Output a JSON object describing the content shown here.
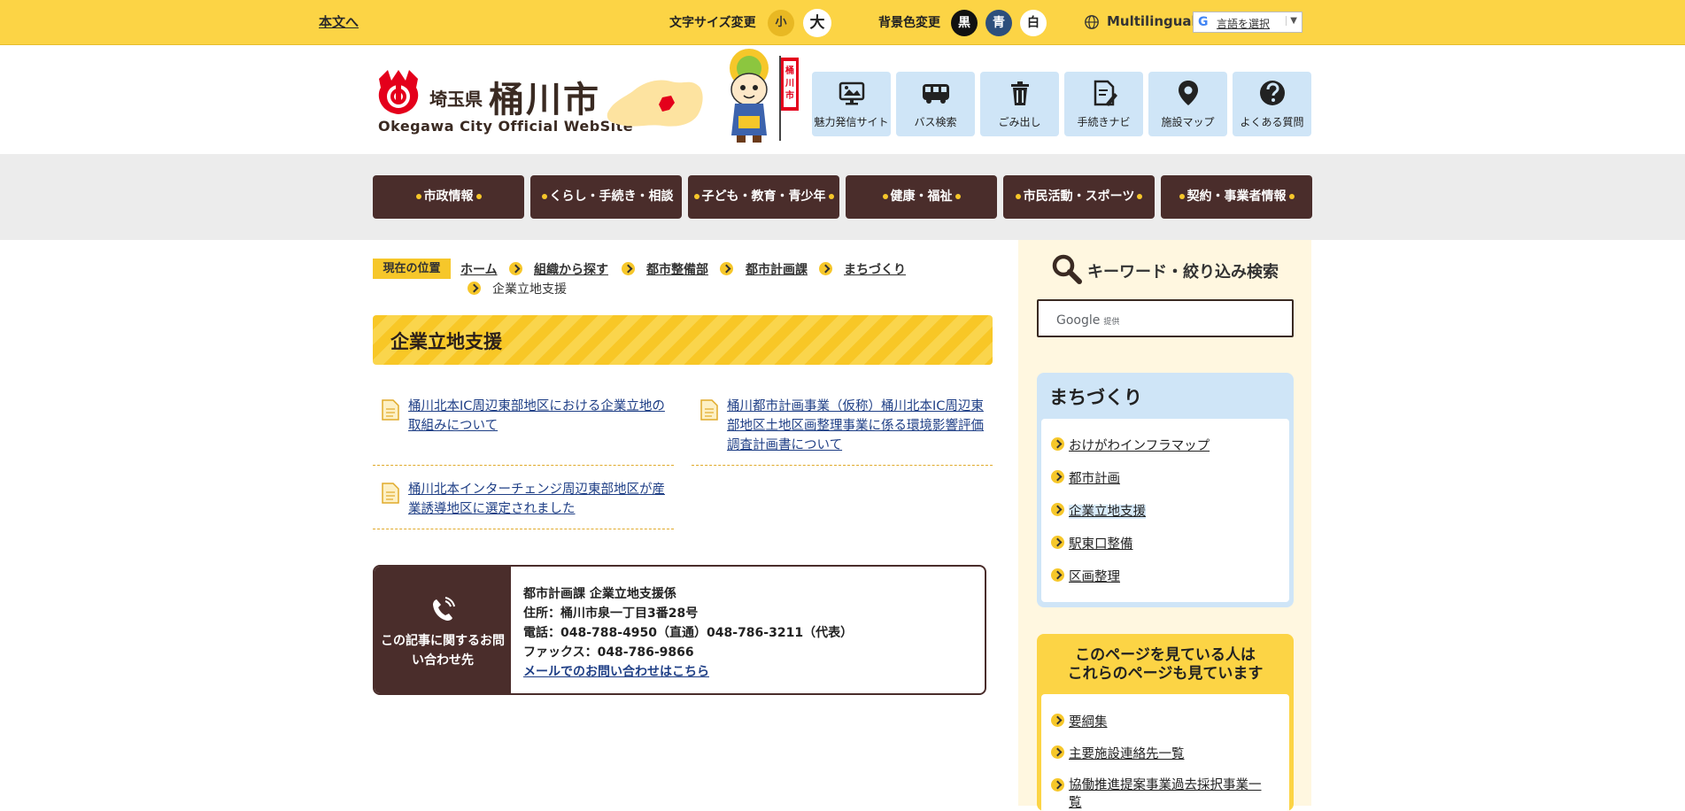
{
  "topbar": {
    "skip_link": "本文へ",
    "font_size_label": "文字サイズ変更",
    "font_small": "小",
    "font_large": "大",
    "bg_color_label": "背景色変更",
    "bg_black": "黒",
    "bg_blue": "青",
    "bg_white": "白",
    "multilingual": "Multilingual",
    "language_select": "言語を選択",
    "language_g": "G"
  },
  "header": {
    "logo_pref": "埼玉県",
    "logo_city": "桶川市",
    "logo_en": "Okegawa City Official WebSite",
    "mascot_flag": "桶川市"
  },
  "quick_nav": [
    {
      "label": "魅力発信サイト",
      "icon": "monitor-icon"
    },
    {
      "label": "バス検索",
      "icon": "bus-icon"
    },
    {
      "label": "ごみ出し",
      "icon": "trash-icon"
    },
    {
      "label": "手続きナビ",
      "icon": "document-pen-icon"
    },
    {
      "label": "施設マップ",
      "icon": "map-pin-icon"
    },
    {
      "label": "よくある質問",
      "icon": "question-icon"
    }
  ],
  "global_nav": [
    {
      "label": "市政情報"
    },
    {
      "label": "くらし・手続き・相談"
    },
    {
      "label": "子ども・教育・青少年"
    },
    {
      "label": "健康・福祉"
    },
    {
      "label": "市民活動・スポーツ"
    },
    {
      "label": "契約・事業者情報"
    }
  ],
  "breadcrumb": {
    "label": "現在の位置",
    "items": [
      "ホーム",
      "組織から探す",
      "都市整備部",
      "都市計画課",
      "まちづくり"
    ],
    "current": "企業立地支援"
  },
  "page": {
    "title": "企業立地支援"
  },
  "documents": [
    {
      "title": "桶川北本IC周辺東部地区における企業立地の取組みについて"
    },
    {
      "title": "桶川都市計画事業（仮称）桶川北本IC周辺東部地区土地区画整理事業に係る環境影響評価調査計画書について"
    },
    {
      "title": "桶川北本インターチェンジ周辺東部地区が産業誘導地区に選定されました"
    }
  ],
  "contact": {
    "label": "この記事に関するお問い合わせ先",
    "dept": "都市計画課 企業立地支援係",
    "address": "住所：桶川市泉一丁目3番28号",
    "phone": "電話：048-788-4950（直通）048-786-3211（代表）",
    "fax": "ファックス：048-786-9866",
    "mail_link": "メールでのお問い合わせはこちら"
  },
  "search": {
    "title": "キーワード・絞り込み検索",
    "google_label": "Google",
    "provided": "提供"
  },
  "sidebar_section": {
    "title": "まちづくり",
    "items": [
      "おけがわインフラマップ",
      "都市計画",
      "企業立地支援",
      "駅東口整備",
      "区画整理"
    ]
  },
  "popular": {
    "title_line1": "このページを見ている人は",
    "title_line2": "これらのページも見ています",
    "items": [
      "要綱集",
      "主要施設連絡先一覧",
      "協働推進提案事業過去採択事業一覧"
    ]
  },
  "colors": {
    "topbar": "#fcd445",
    "nav_brown": "#4a2d2b",
    "accent_yellow": "#f6c72a",
    "quick_nav_bg": "#cfe5f7"
  }
}
